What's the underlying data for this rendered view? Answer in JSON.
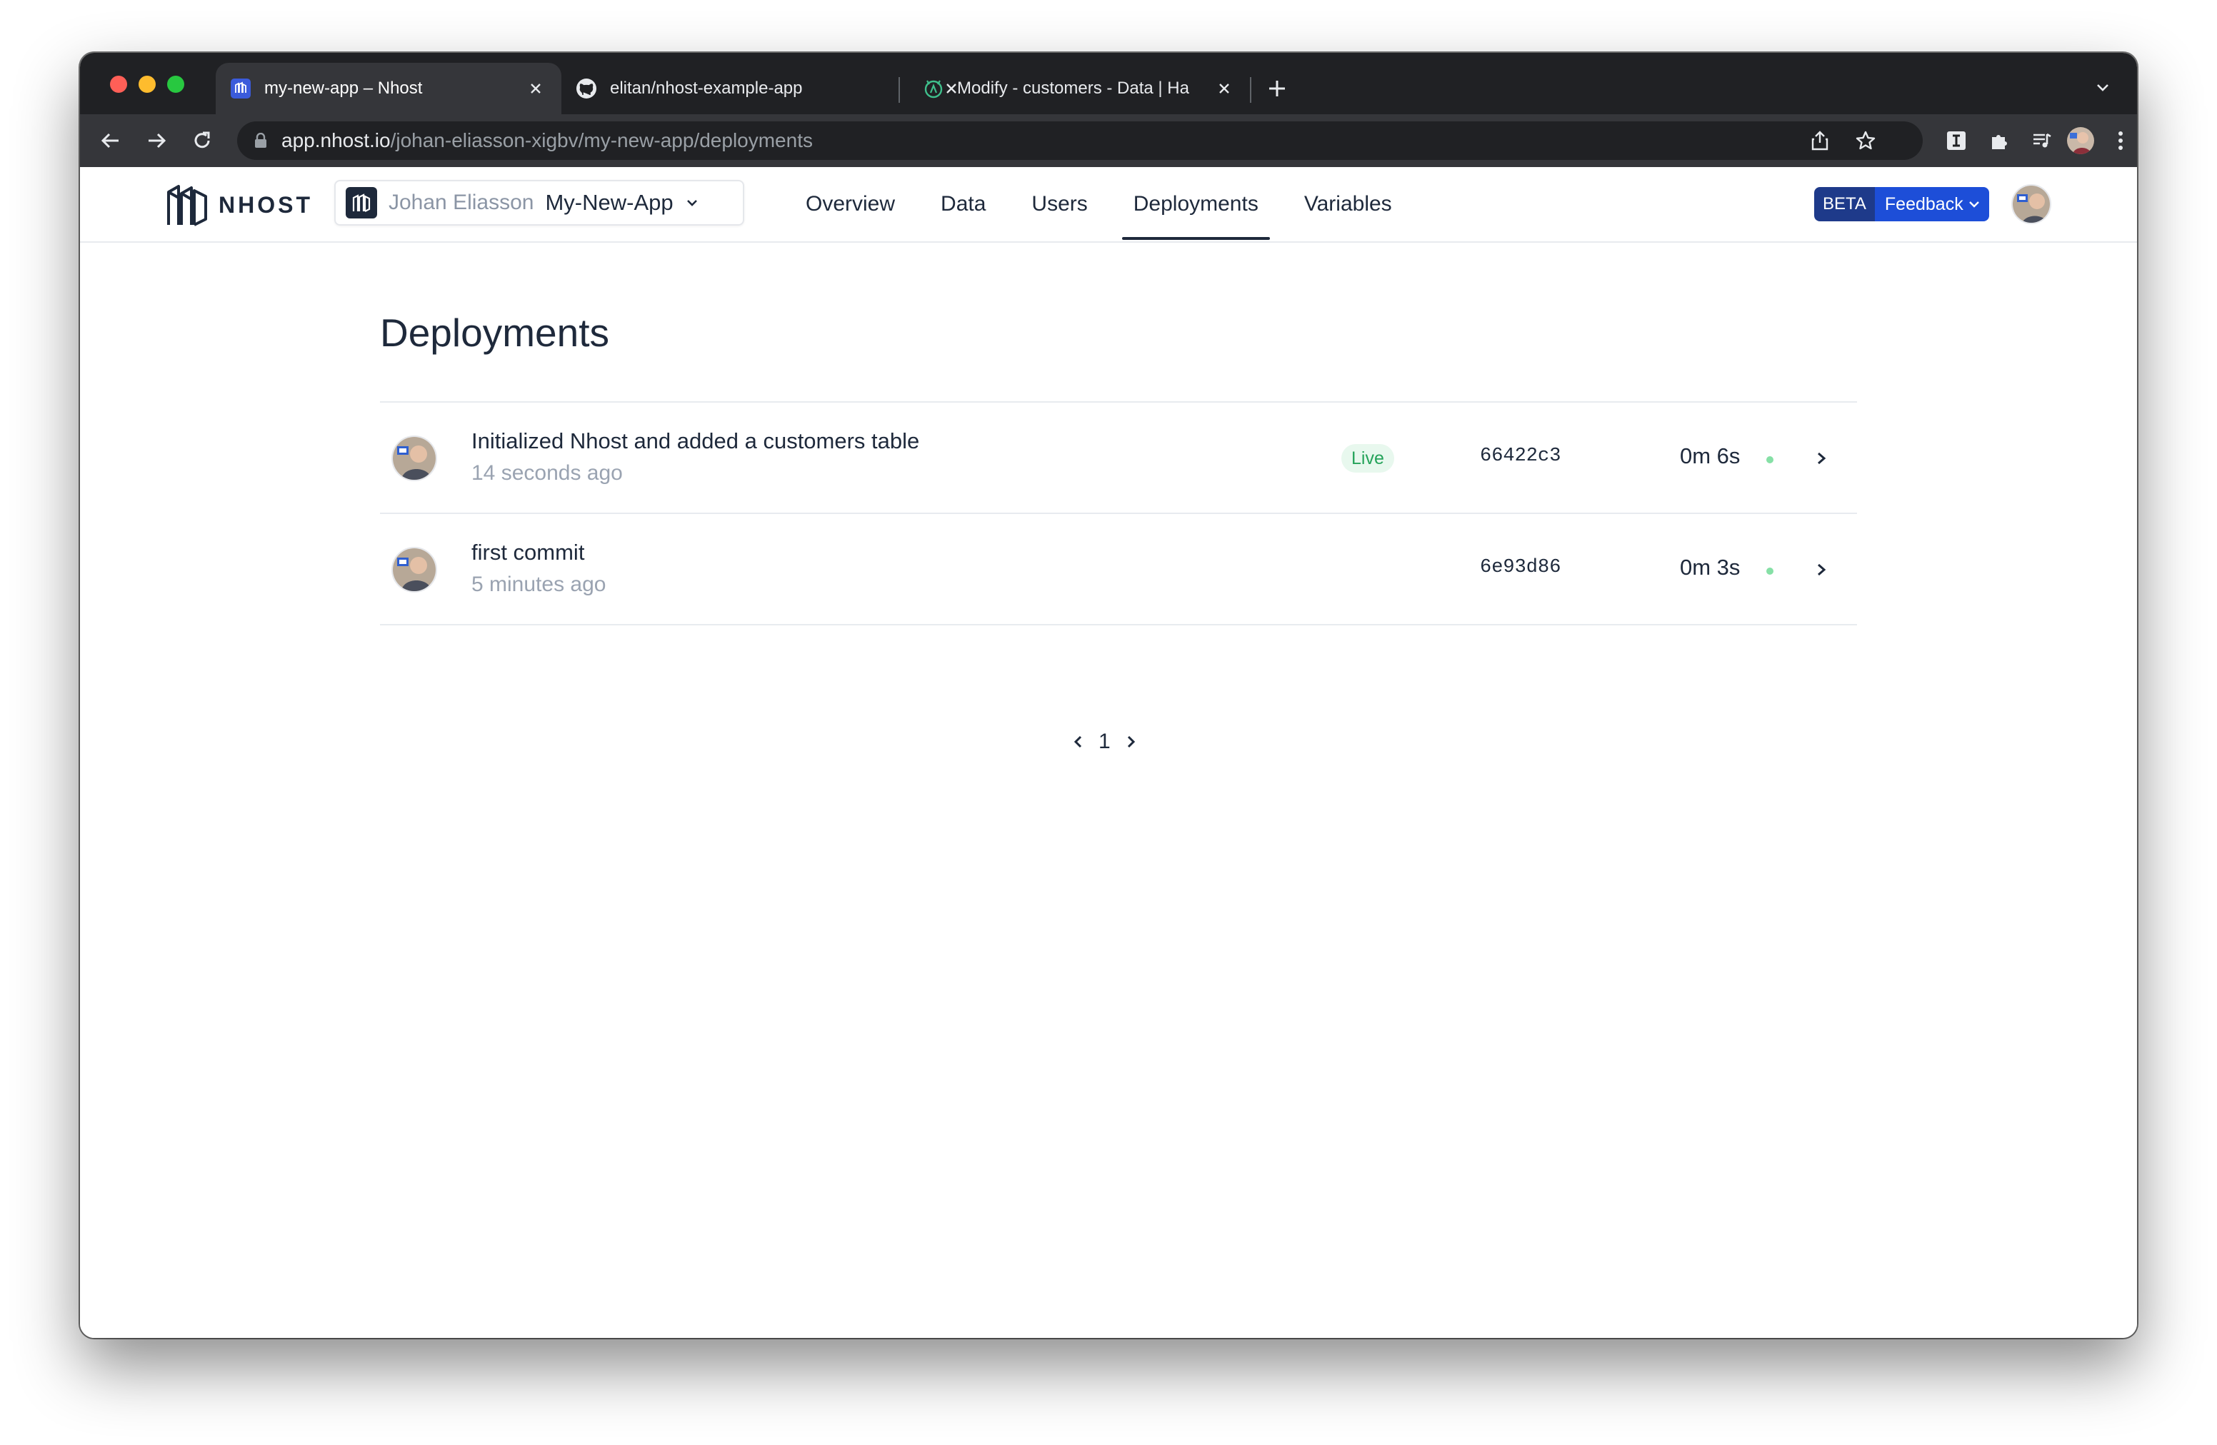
{
  "browser": {
    "tabs": [
      {
        "title": "my-new-app – Nhost",
        "favicon": "nhost-icon",
        "active": true
      },
      {
        "title": "elitan/nhost-example-app",
        "favicon": "github-icon",
        "active": false
      },
      {
        "title": "Modify - customers - Data | Ha",
        "favicon": "hasura-icon",
        "active": false
      }
    ],
    "url_host": "app.nhost.io",
    "url_path": "/johan-eliasson-xigbv/my-new-app/deployments"
  },
  "header": {
    "logo_text": "NHOST",
    "project_owner": "Johan Eliasson",
    "project_name": "My-New-App",
    "nav": [
      {
        "label": "Overview",
        "active": false
      },
      {
        "label": "Data",
        "active": false
      },
      {
        "label": "Users",
        "active": false
      },
      {
        "label": "Deployments",
        "active": true
      },
      {
        "label": "Variables",
        "active": false
      }
    ],
    "beta_label": "BETA",
    "feedback_label": "Feedback"
  },
  "main": {
    "title": "Deployments",
    "deployments": [
      {
        "message": "Initialized Nhost and added a customers table",
        "time": "14 seconds ago",
        "badge": "Live",
        "commit": "66422c3",
        "duration": "0m 6s",
        "status_color": "#86e0a6"
      },
      {
        "message": "first commit",
        "time": "5 minutes ago",
        "badge": "",
        "commit": "6e93d86",
        "duration": "0m 3s",
        "status_color": "#86e0a6"
      }
    ],
    "pagination": {
      "current_page": "1"
    }
  },
  "colors": {
    "tab_strip": "#202124",
    "toolbar": "#35363a",
    "text_primary": "#1e293b",
    "text_muted": "#9aa3b1",
    "live_badge_bg": "#e8f8ee",
    "live_badge_text": "#25a35a",
    "feedback_blue": "#1d4ed8",
    "beta_navy": "#1e3a8a"
  }
}
